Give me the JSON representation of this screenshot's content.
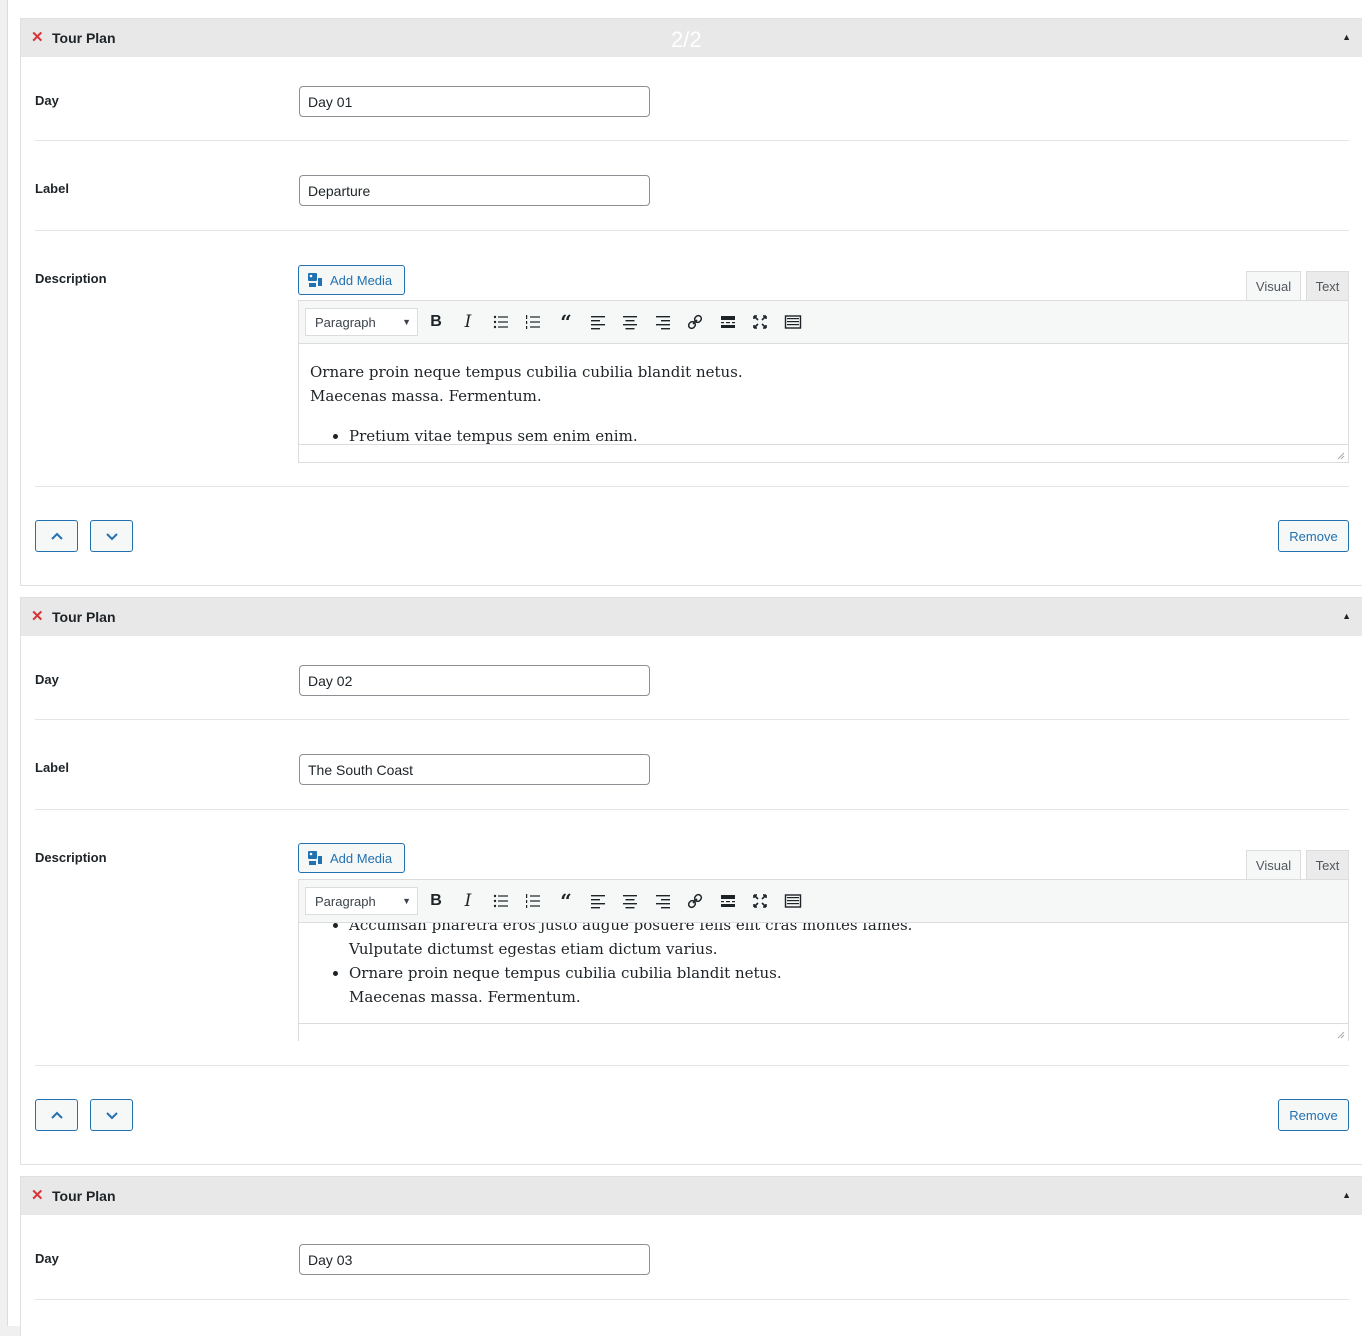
{
  "page_counter": "2/2",
  "panel_title": "Tour Plan",
  "labels": {
    "day": "Day",
    "label": "Label",
    "description": "Description"
  },
  "editor": {
    "add_media": "Add Media",
    "tab_visual": "Visual",
    "tab_text": "Text",
    "format": "Paragraph",
    "toolbar_icons": [
      "bold-icon",
      "italic-icon",
      "bullet-list-icon",
      "numbered-list-icon",
      "blockquote-icon",
      "align-left-icon",
      "align-center-icon",
      "align-right-icon",
      "link-icon",
      "read-more-icon",
      "fullscreen-icon",
      "toolbar-toggle-icon"
    ]
  },
  "remove_label": "Remove",
  "plans": [
    {
      "day": "Day 01",
      "label": "Departure",
      "paragraph": [
        "Ornare proin neque tempus cubilia cubilia blandit netus.",
        "Maecenas massa. Fermentum."
      ],
      "bullets": [
        [
          "Pretium vitae tempus sem enim enim."
        ]
      ]
    },
    {
      "day": "Day 02",
      "label": "The South Coast",
      "bullets": [
        [
          "Accumsan pharetra eros justo augue posuere felis elit cras montes fames.",
          "Vulputate dictumst egestas etiam dictum varius."
        ],
        [
          "Ornare proin neque tempus cubilia cubilia blandit netus.",
          "Maecenas massa. Fermentum."
        ]
      ]
    },
    {
      "day": "Day 03"
    }
  ]
}
